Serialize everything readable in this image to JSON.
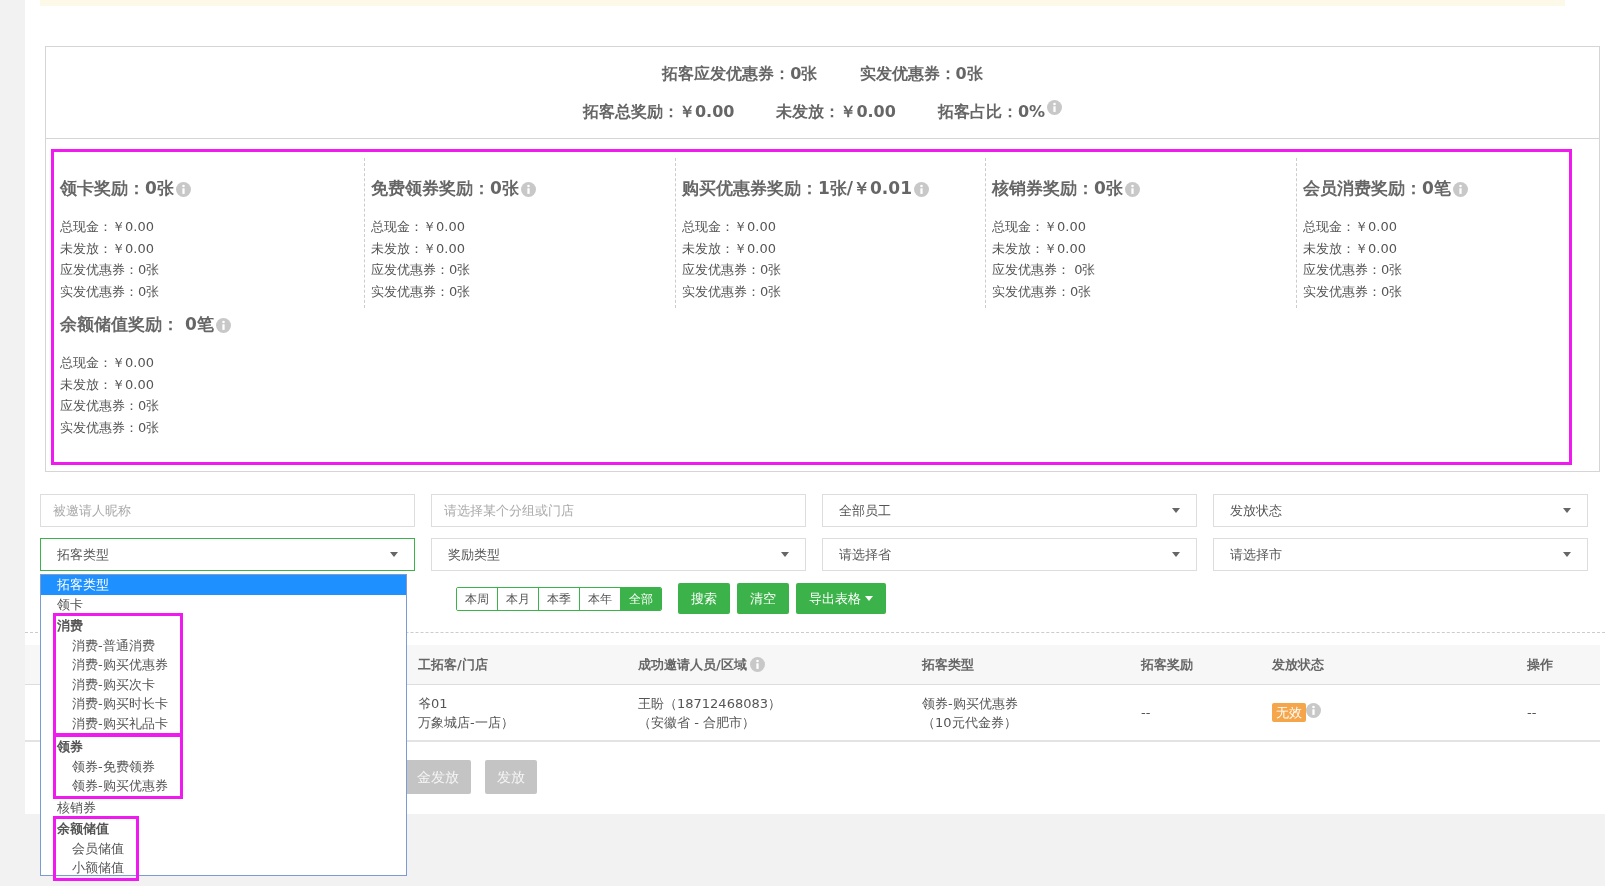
{
  "summary": {
    "line_1": [
      {
        "text": "拓客应发优惠券：0张"
      },
      {
        "text": "实发优惠券：0张"
      }
    ],
    "line_2": [
      {
        "text": "拓客总奖励：￥0.00"
      },
      {
        "text": "未发放：￥0.00"
      },
      {
        "text": "拓客占比：0%",
        "info": true
      }
    ]
  },
  "reward_cards": {
    "framed": true,
    "cards": [
      {
        "title": "领卡奖励：0张",
        "lines": [
          "总现金：￥0.00",
          "未发放：￥0.00",
          "应发优惠券：0张",
          "实发优惠券：0张"
        ]
      },
      {
        "title": "免费领券奖励：0张",
        "lines": [
          "总现金：￥0.00",
          "未发放：￥0.00",
          "应发优惠券：0张",
          "实发优惠券：0张"
        ]
      },
      {
        "title": "购买优惠券奖励：1张/￥0.01",
        "lines": [
          "总现金：￥0.00",
          "未发放：￥0.00",
          "应发优惠券：0张",
          "实发优惠券：0张"
        ]
      },
      {
        "title": "核销券奖励：0张",
        "lines": [
          "总现金：￥0.00",
          "未发放：￥0.00",
          "应发优惠券： 0张",
          "实发优惠券：0张"
        ]
      },
      {
        "title": "会员消费奖励：0笔",
        "lines": [
          "总现金：￥0.00",
          "未发放：￥0.00",
          "应发优惠券：0张",
          "实发优惠券：0张"
        ]
      },
      {
        "title": "余额储值奖励： 0笔",
        "lines": [
          "总现金：￥0.00",
          "未发放：￥0.00",
          "应发优惠券：0张",
          "实发优惠券：0张"
        ]
      }
    ]
  },
  "filters": [
    {
      "kind": "input",
      "placeholder": "被邀请人昵称"
    },
    {
      "kind": "input",
      "placeholder": "请选择某个分组或门店"
    },
    {
      "kind": "select",
      "value": "全部员工",
      "focused": false
    },
    {
      "kind": "select",
      "value": "发放状态",
      "focused": false
    },
    {
      "kind": "select",
      "value": "拓客类型",
      "focused": true
    },
    {
      "kind": "select",
      "value": "奖励类型",
      "focused": false
    },
    {
      "kind": "select",
      "value": "请选择省",
      "focused": false
    },
    {
      "kind": "select",
      "value": "请选择市",
      "focused": false
    }
  ],
  "dropdown": {
    "items": [
      {
        "kind": "option",
        "label": "拓客类型",
        "selected": true
      },
      {
        "kind": "option",
        "label": "领卡",
        "selected": false
      },
      {
        "kind": "group",
        "label": "消费",
        "framed": true,
        "children": [
          {
            "label": "消费-普通消费",
            "selected": false
          },
          {
            "label": "消费-购买优惠券",
            "selected": false
          },
          {
            "label": "消费-购买次卡",
            "selected": false
          },
          {
            "label": "消费-购买时长卡",
            "selected": false
          },
          {
            "label": "消费-购买礼品卡",
            "selected": false
          }
        ]
      },
      {
        "kind": "group",
        "label": "领券",
        "framed": true,
        "children": [
          {
            "label": "领券-免费领券",
            "selected": false
          },
          {
            "label": "领券-购买优惠券",
            "selected": false
          }
        ]
      },
      {
        "kind": "option",
        "label": "核销券",
        "selected": false
      },
      {
        "kind": "group",
        "label": "余额储值",
        "framed": true,
        "children": [
          {
            "label": "会员储值",
            "selected": false
          },
          {
            "label": "小额储值",
            "selected": false
          }
        ]
      }
    ]
  },
  "period_tabs": [
    {
      "label": "本周",
      "selected": false
    },
    {
      "label": "本月",
      "selected": false
    },
    {
      "label": "本季",
      "selected": false
    },
    {
      "label": "本年",
      "selected": false
    },
    {
      "label": "全部",
      "selected": true
    }
  ],
  "actions": [
    {
      "label": "搜索",
      "caret": false
    },
    {
      "label": "清空",
      "caret": false
    },
    {
      "label": "导出表格",
      "caret": true
    }
  ],
  "table": {
    "columns": [
      {
        "label": "工拓客/门店"
      },
      {
        "label": "成功邀请人员/区域",
        "info": true
      },
      {
        "label": "拓客类型"
      },
      {
        "label": "拓客奖励"
      },
      {
        "label": "发放状态"
      },
      {
        "label": "操作"
      }
    ],
    "rows": [
      {
        "cells": [
          [
            "爷01",
            "万象城店-一店）"
          ],
          [
            "王盼（18712468083）",
            "（安徽省 - 合肥市）"
          ],
          [
            "领券-购买优惠券",
            "（10元代金券）"
          ],
          [
            "--"
          ]
        ],
        "status": {
          "label": "无效",
          "info": true
        },
        "operation": "--"
      }
    ]
  },
  "bottom_buttons": [
    {
      "label": "金发放",
      "disabled": true
    },
    {
      "label": "发放",
      "disabled": true
    }
  ]
}
